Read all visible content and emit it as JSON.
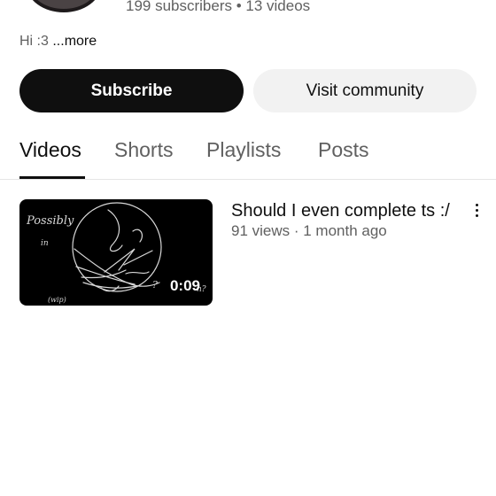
{
  "channel": {
    "stats": "199 subscribers • 13 videos",
    "description": "Hi :3",
    "more_label": " ...more"
  },
  "actions": {
    "subscribe_label": "Subscribe",
    "community_label": "Visit community"
  },
  "tabs": [
    {
      "label": "Videos",
      "active": true
    },
    {
      "label": "Shorts",
      "active": false
    },
    {
      "label": "Playlists",
      "active": false
    },
    {
      "label": "Posts",
      "active": false
    }
  ],
  "videos": [
    {
      "title": "Should I even complete ts :/",
      "meta": "91 views · 1 month ago",
      "duration": "0:09"
    }
  ],
  "colors": {
    "text_primary": "#0f0f0f",
    "text_secondary": "#606060",
    "button_primary_bg": "#0f0f0f",
    "button_secondary_bg": "#f2f2f2"
  },
  "icons": [
    "more-vert-icon"
  ]
}
